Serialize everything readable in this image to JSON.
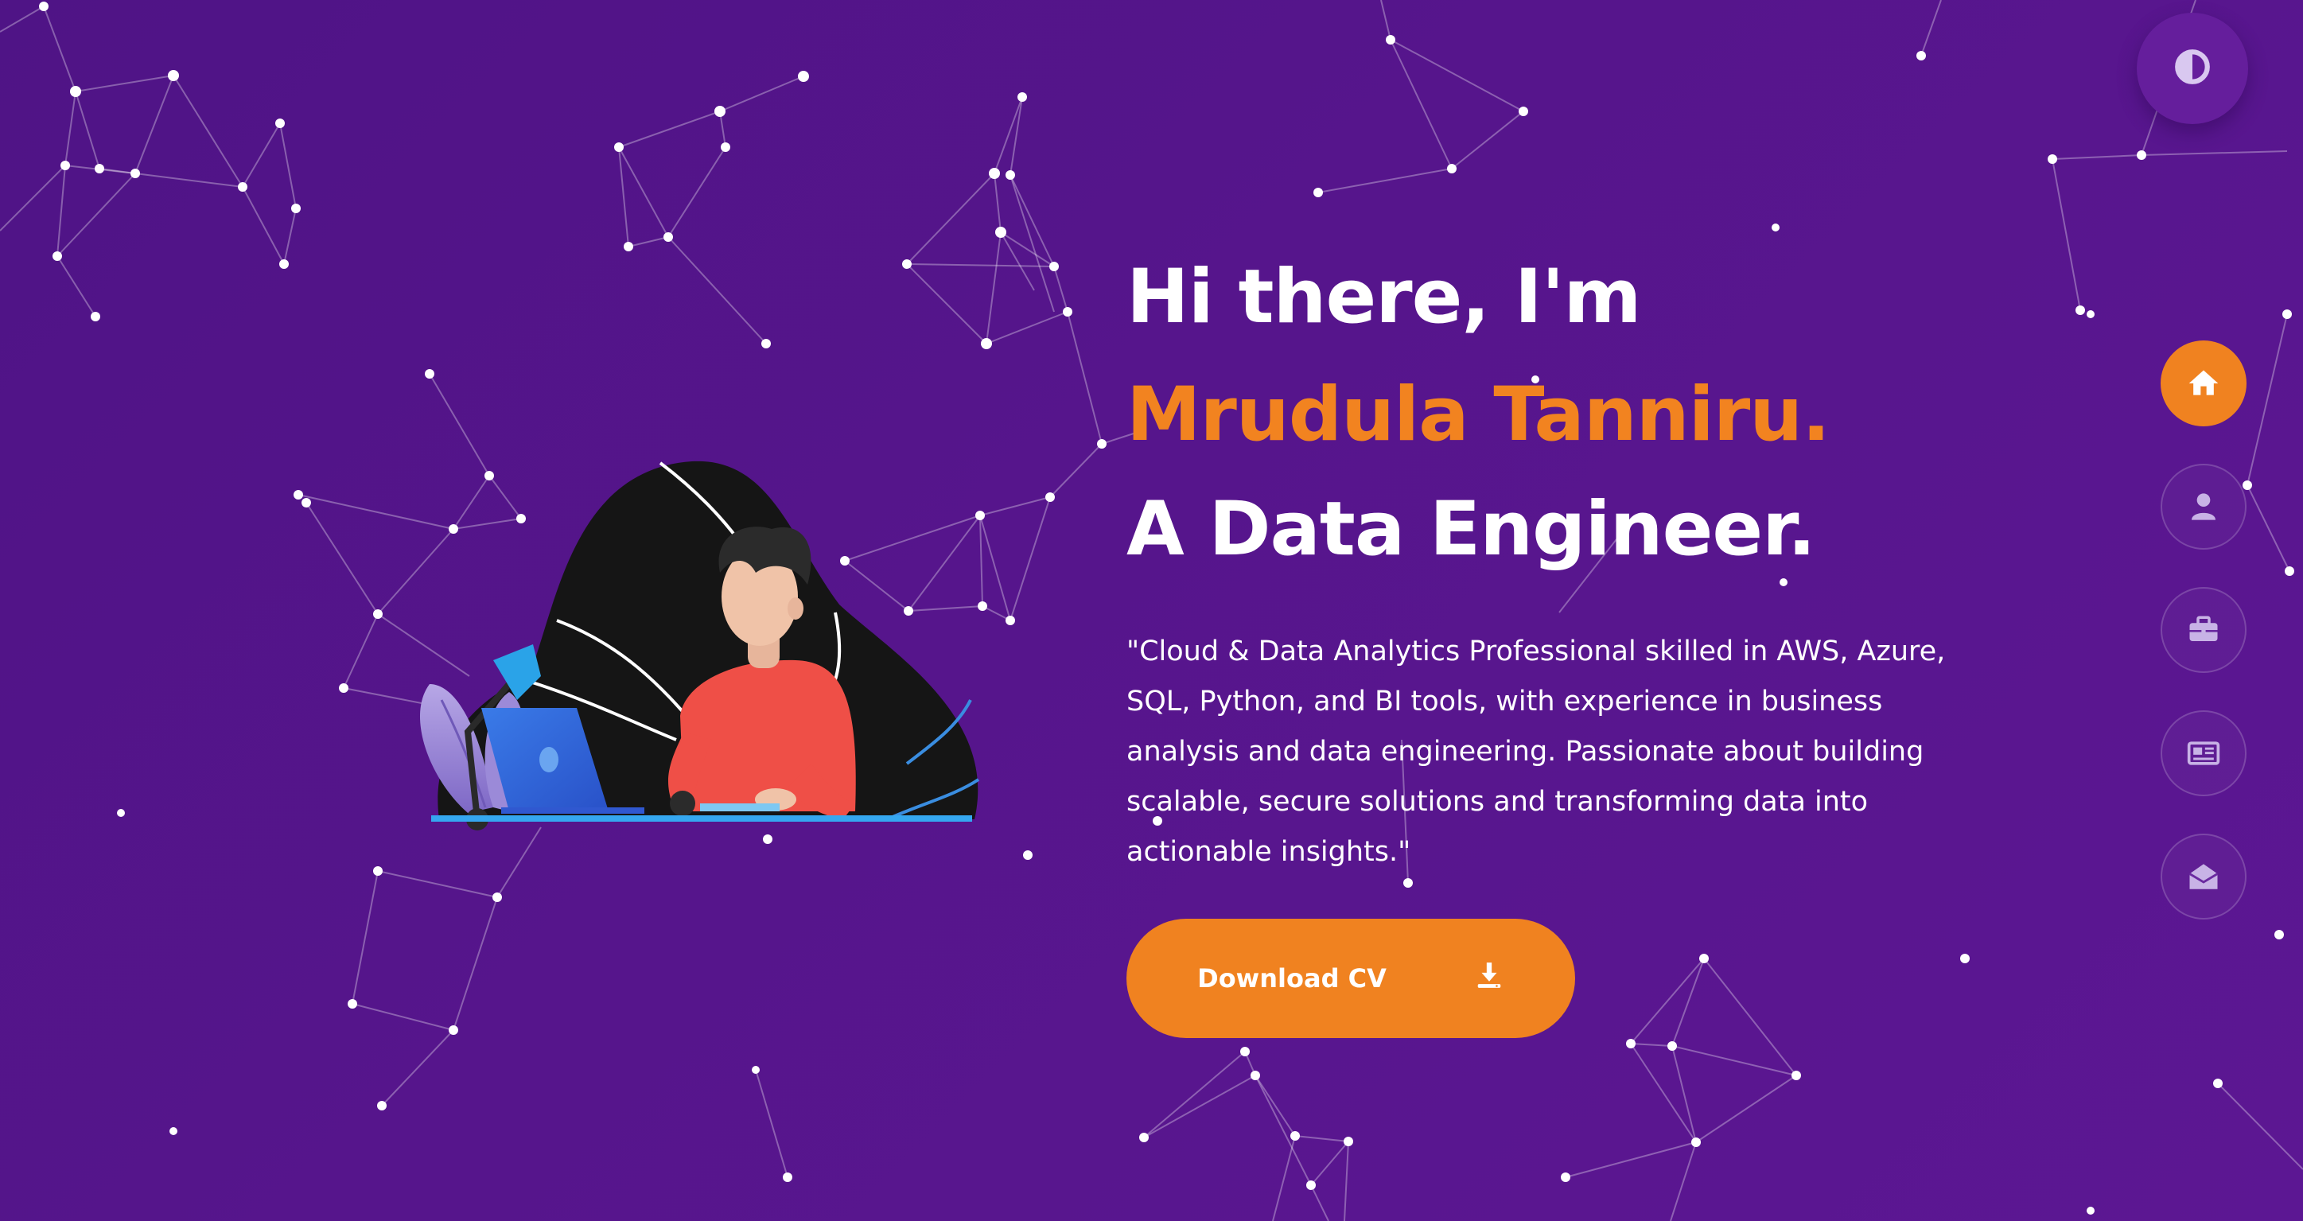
{
  "hero": {
    "greeting": "Hi there, I'm ",
    "name": "Mrudula Tanniru.",
    "role": "A Data Engineer.",
    "bio": "\"Cloud & Data Analytics Professional skilled in AWS, Azure, SQL, Python, and BI tools, with experience in business analysis and data engineering. Passionate about building scalable, secure solutions and transforming data into actionable insights.\"",
    "cta_label": "Download CV",
    "cta_icon": "download-icon"
  },
  "theme_toggle": {
    "icon": "contrast-icon"
  },
  "nav": [
    {
      "icon": "home-icon",
      "active": true
    },
    {
      "icon": "user-icon",
      "active": false
    },
    {
      "icon": "briefcase-icon",
      "active": false
    },
    {
      "icon": "newspaper-icon",
      "active": false
    },
    {
      "icon": "envelope-open-icon",
      "active": false
    }
  ],
  "colors": {
    "background": "#56158c",
    "accent": "#f08220",
    "text": "#ffffff"
  }
}
